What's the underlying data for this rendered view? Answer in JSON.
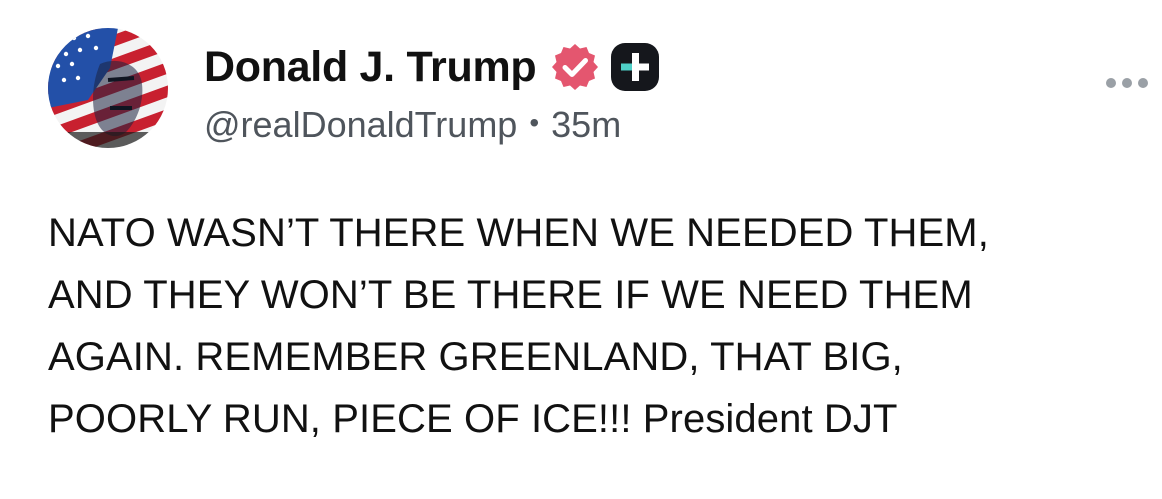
{
  "post": {
    "author": {
      "display_name": "Donald J. Trump",
      "handle": "@realDonaldTrump",
      "avatar_icon": "flag-portrait-avatar",
      "verified_icon": "verified-badge-icon",
      "verified_color": "#e4566f",
      "plus_icon": "plus-badge-icon"
    },
    "separator": "•",
    "timestamp": "35m",
    "more_icon": "more-options-icon",
    "content_lines": [
      "NATO WASN’T THERE WHEN WE NEEDED THEM,",
      "AND THEY WON’T BE THERE IF WE NEED THEM",
      "AGAIN. REMEMBER GREENLAND, THAT BIG,",
      "POORLY RUN, PIECE OF ICE!!! President DJT"
    ]
  }
}
